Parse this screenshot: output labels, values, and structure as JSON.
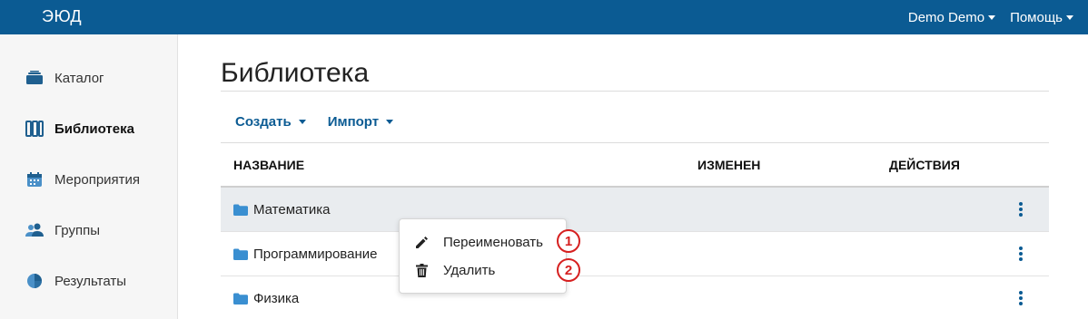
{
  "app": {
    "logo": "ЭЮД"
  },
  "navbar": {
    "user_menu": "Demo Demo",
    "help_menu": "Помощь"
  },
  "sidebar": {
    "items": [
      {
        "label": "Каталог",
        "icon": "catalog-icon",
        "active": false
      },
      {
        "label": "Библиотека",
        "icon": "library-icon",
        "active": true
      },
      {
        "label": "Мероприятия",
        "icon": "calendar-icon",
        "active": false
      },
      {
        "label": "Группы",
        "icon": "users-icon",
        "active": false
      },
      {
        "label": "Результаты",
        "icon": "pie-chart-icon",
        "active": false
      }
    ]
  },
  "main": {
    "title": "Библиотека",
    "toolbar": {
      "create": "Создать",
      "import": "Импорт"
    },
    "table": {
      "columns": [
        "НАЗВАНИЕ",
        "ИЗМЕНЕН",
        "ДЕЙСТВИЯ"
      ],
      "rows": [
        {
          "name": "Математика",
          "icon": "folder-icon"
        },
        {
          "name": "Программирование",
          "icon": "folder-icon"
        },
        {
          "name": "Физика",
          "icon": "folder-icon"
        }
      ]
    }
  },
  "context_menu": {
    "items": [
      {
        "label": "Переименовать",
        "icon": "pencil-icon",
        "marker": "1"
      },
      {
        "label": "Удалить",
        "icon": "trash-icon",
        "marker": "2"
      }
    ]
  },
  "colors": {
    "brand": "#0b5b93",
    "marker": "#d62020",
    "row_highlight": "#e9ecef"
  }
}
